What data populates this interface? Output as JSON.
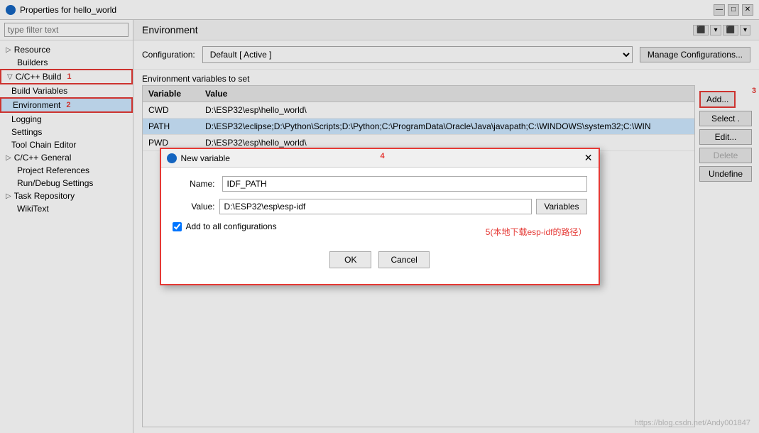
{
  "titleBar": {
    "title": "Properties for hello_world",
    "minBtn": "—",
    "maxBtn": "□",
    "closeBtn": "✕"
  },
  "leftPanel": {
    "searchPlaceholder": "type filter text",
    "tree": [
      {
        "id": "resource",
        "label": "Resource",
        "indent": 1,
        "expandable": true
      },
      {
        "id": "builders",
        "label": "Builders",
        "indent": 1,
        "expandable": false
      },
      {
        "id": "cpp-build",
        "label": "C/C++ Build",
        "indent": 1,
        "expandable": true,
        "highlighted": true,
        "badge": "1"
      },
      {
        "id": "build-variables",
        "label": "Build Variables",
        "indent": 2
      },
      {
        "id": "environment",
        "label": "Environment",
        "indent": 2,
        "selected": true,
        "highlighted": true,
        "badge": "2"
      },
      {
        "id": "logging",
        "label": "Logging",
        "indent": 2
      },
      {
        "id": "settings",
        "label": "Settings",
        "indent": 2
      },
      {
        "id": "tool-chain-editor",
        "label": "Tool Chain Editor",
        "indent": 2
      },
      {
        "id": "cpp-general",
        "label": "C/C++ General",
        "indent": 1,
        "expandable": true
      },
      {
        "id": "project-references",
        "label": "Project References",
        "indent": 1
      },
      {
        "id": "run-debug-settings",
        "label": "Run/Debug Settings",
        "indent": 1
      },
      {
        "id": "task-repository",
        "label": "Task Repository",
        "indent": 1,
        "expandable": true
      },
      {
        "id": "wikitext",
        "label": "WikiText",
        "indent": 1
      }
    ]
  },
  "rightPanel": {
    "headerTitle": "Environment",
    "configLabel": "Configuration:",
    "configValue": "Default  [ Active ]",
    "manageBtn": "Manage Configurations...",
    "envSectionTitle": "Environment variables to set",
    "tableHeaders": {
      "variable": "Variable",
      "value": "Value"
    },
    "tableRows": [
      {
        "var": "CWD",
        "val": "D:\\ESP32\\esp\\hello_world\\",
        "selected": false
      },
      {
        "var": "PATH",
        "val": "D:\\ESP32\\eclipse;D:\\Python\\Scripts;D:\\Python;C:\\ProgramData\\Oracle\\Java\\javapath;C:\\WINDOWS\\system32;C:\\WIN",
        "selected": true
      },
      {
        "var": "PWD",
        "val": "D:\\ESP32\\esp\\hello_world\\",
        "selected": false
      }
    ],
    "buttons": {
      "add": "Add...",
      "select": "Select .",
      "edit": "Edit...",
      "delete": "Delete",
      "undefine": "Undefine"
    },
    "badge3": "3"
  },
  "dialog": {
    "title": "New variable",
    "badge4": "4",
    "closeBtn": "✕",
    "nameLabel": "Name:",
    "nameValue": "IDF_PATH",
    "valueLabel": "Value:",
    "valueValue": "D:\\ESP32\\esp\\esp-idf",
    "variablesBtn": "Variables",
    "checkboxLabel": "Add to all configurations",
    "annotation": "5(本地下载esp-idf的路径）",
    "okBtn": "OK",
    "cancelBtn": "Cancel"
  },
  "watermark": "https://blog.csdn.net/Andy001847"
}
